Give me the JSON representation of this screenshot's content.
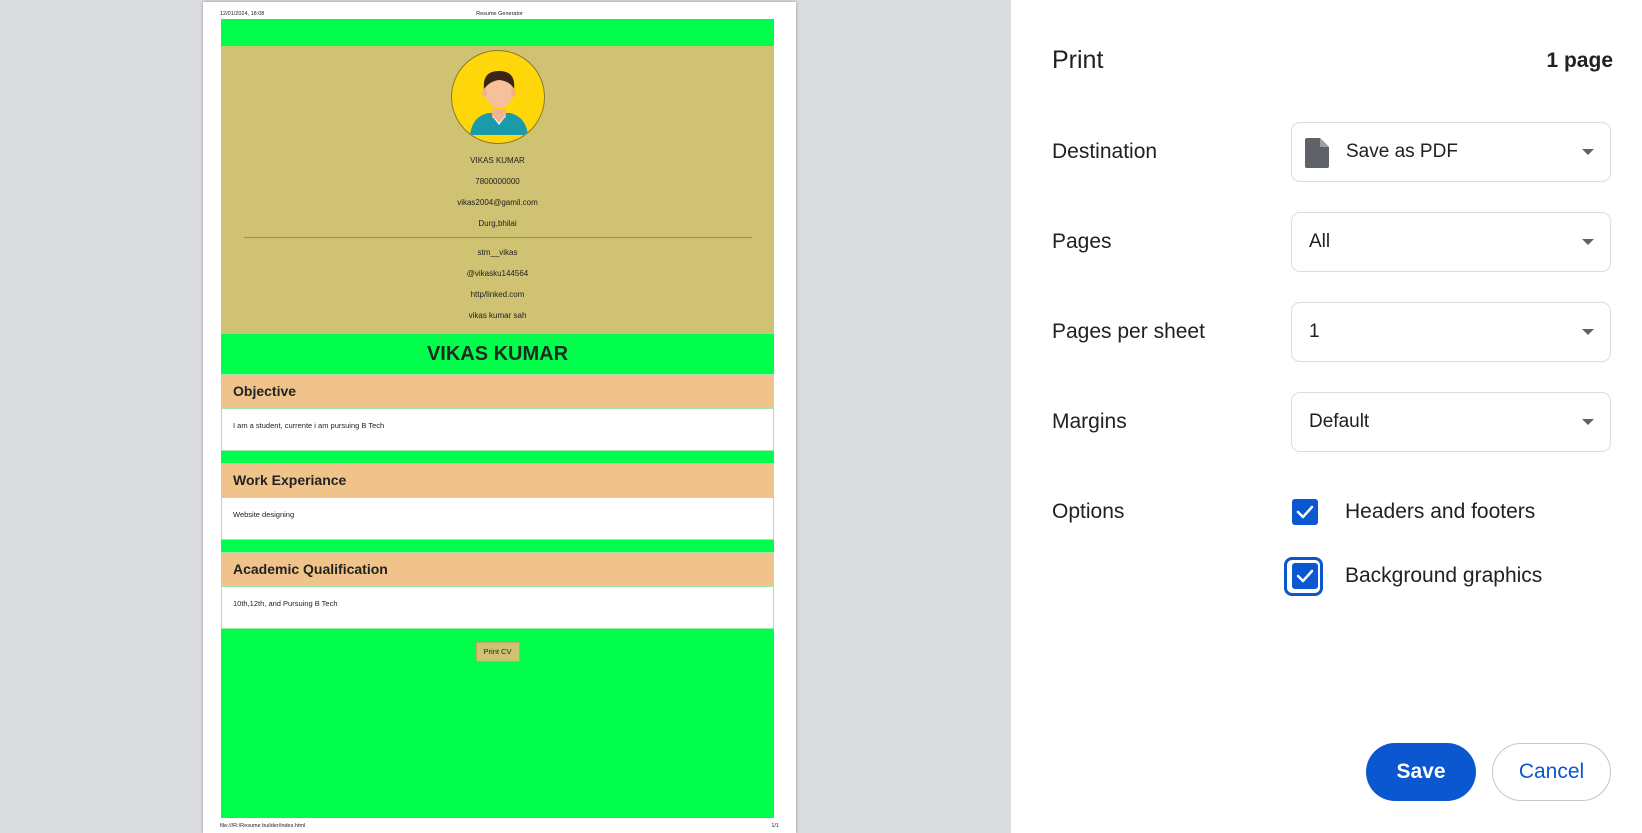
{
  "preview": {
    "header_date": "12/01/2024, 18:08",
    "header_title": "Resume Generator",
    "footer_path": "file:///R:/Resume builder/index.html",
    "footer_page": "1/1",
    "cv": {
      "profile": {
        "name": "VIKAS KUMAR",
        "phone": "7800000000",
        "email": "vikas2004@gamil.com",
        "location": "Durg,bhilai",
        "instagram": "stm__vikas",
        "twitter": "@vikasku144564",
        "linkedin": "http/linked.com",
        "facebook": "vikas kumar sah"
      },
      "name_banner": "VIKAS KUMAR",
      "sections": [
        {
          "title": "Objective",
          "body": "I am a student, currente i am pursuing B Tech"
        },
        {
          "title": "Work Experiance",
          "body": "Website designing"
        },
        {
          "title": "Academic Qualification",
          "body": "10th,12th, and Pursuing B Tech"
        }
      ],
      "print_button": "Print CV",
      "colors": {
        "band": "#00ff4c",
        "profile_bg": "#cfc272",
        "section_head": "#f0c38a",
        "avatar_bg": "#ffd60a"
      }
    }
  },
  "panel": {
    "title": "Print",
    "page_count": "1 page",
    "destination": {
      "label": "Destination",
      "value": "Save as PDF",
      "icon": "document-icon"
    },
    "pages": {
      "label": "Pages",
      "value": "All"
    },
    "pages_per_sheet": {
      "label": "Pages per sheet",
      "value": "1"
    },
    "margins": {
      "label": "Margins",
      "value": "Default"
    },
    "options": {
      "label": "Options",
      "headers_footers": {
        "label": "Headers and footers",
        "checked": true
      },
      "background_graphics": {
        "label": "Background graphics",
        "checked": true
      }
    },
    "save_label": "Save",
    "cancel_label": "Cancel",
    "accent": "#0b57d0"
  }
}
